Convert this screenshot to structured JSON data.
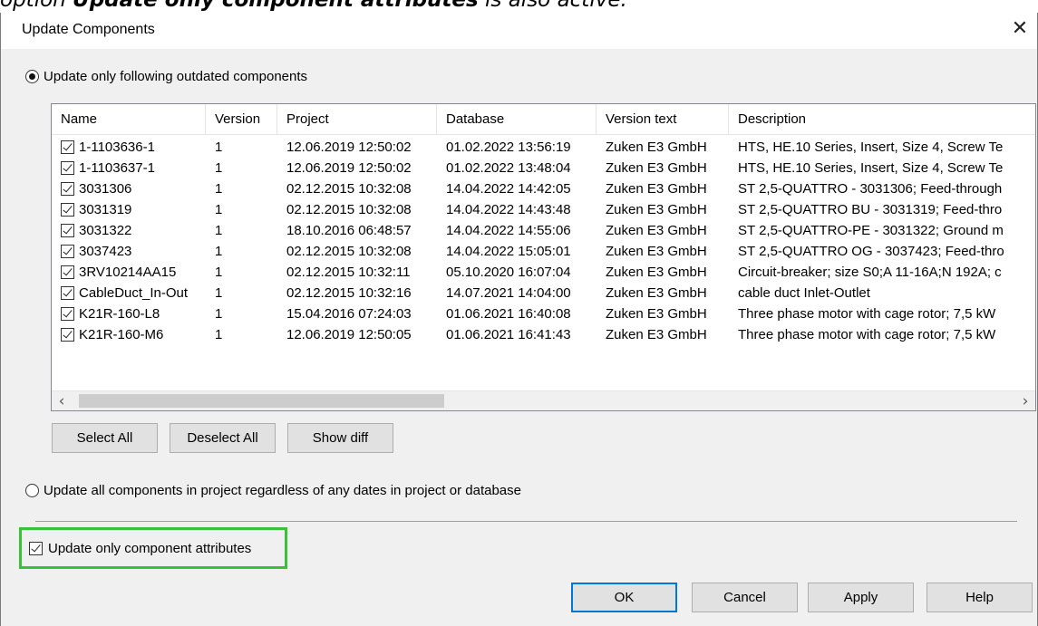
{
  "caption": {
    "prefix": "option ",
    "bold_part": "Update only component attributes",
    "suffix": " is also active."
  },
  "dialog": {
    "title": "Update Components",
    "close_glyph": "✕"
  },
  "option_outdated": {
    "label": "Update only following outdated components",
    "selected": true
  },
  "table": {
    "columns": [
      "Name",
      "Version",
      "Project",
      "Database",
      "Version text",
      "Description"
    ],
    "rows": [
      {
        "name": "1-1103636-1",
        "version": "1",
        "project": "12.06.2019 12:50:02",
        "database": "01.02.2022 13:56:19",
        "version_text": "Zuken E3 GmbH",
        "description": "HTS, HE.10 Series, Insert, Size 4, Screw Te"
      },
      {
        "name": "1-1103637-1",
        "version": "1",
        "project": "12.06.2019 12:50:02",
        "database": "01.02.2022 13:48:04",
        "version_text": "Zuken E3 GmbH",
        "description": "HTS, HE.10 Series, Insert, Size 4, Screw Te"
      },
      {
        "name": "3031306",
        "version": "1",
        "project": "02.12.2015 10:32:08",
        "database": "14.04.2022 14:42:05",
        "version_text": "Zuken E3 GmbH",
        "description": "ST 2,5-QUATTRO - 3031306; Feed-through"
      },
      {
        "name": "3031319",
        "version": "1",
        "project": "02.12.2015 10:32:08",
        "database": "14.04.2022 14:43:48",
        "version_text": "Zuken E3 GmbH",
        "description": "ST 2,5-QUATTRO BU - 3031319; Feed-thro"
      },
      {
        "name": "3031322",
        "version": "1",
        "project": "18.10.2016 06:48:57",
        "database": "14.04.2022 14:55:06",
        "version_text": "Zuken E3 GmbH",
        "description": "ST 2,5-QUATTRO-PE - 3031322; Ground m"
      },
      {
        "name": "3037423",
        "version": "1",
        "project": "02.12.2015 10:32:08",
        "database": "14.04.2022 15:05:01",
        "version_text": "Zuken E3 GmbH",
        "description": "ST 2,5-QUATTRO OG - 3037423; Feed-thro"
      },
      {
        "name": "3RV10214AA15",
        "version": "1",
        "project": "02.12.2015 10:32:11",
        "database": "05.10.2020 16:07:04",
        "version_text": "Zuken E3 GmbH",
        "description": "Circuit-breaker; size S0;A 11-16A;N 192A; c"
      },
      {
        "name": "CableDuct_In-Out",
        "version": "1",
        "project": "02.12.2015 10:32:16",
        "database": "14.07.2021 14:04:00",
        "version_text": "Zuken E3 GmbH",
        "description": "cable duct Inlet-Outlet"
      },
      {
        "name": "K21R-160-L8",
        "version": "1",
        "project": "15.04.2016 07:24:03",
        "database": "01.06.2021 16:40:08",
        "version_text": "Zuken E3 GmbH",
        "description": "Three phase motor with cage rotor; 7,5 kW"
      },
      {
        "name": "K21R-160-M6",
        "version": "1",
        "project": "12.06.2019 12:50:05",
        "database": "01.06.2021 16:41:43",
        "version_text": "Zuken E3 GmbH",
        "description": "Three phase motor with cage rotor; 7,5 kW"
      }
    ]
  },
  "scroll": {
    "left_glyph": "‹",
    "right_glyph": "›"
  },
  "list_buttons": {
    "select_all": "Select All",
    "deselect_all": "Deselect All",
    "show_diff": "Show diff"
  },
  "option_all": {
    "label": "Update all components in project regardless of any dates in project or database",
    "selected": false
  },
  "option_attributes": {
    "label": "Update only component attributes",
    "checked": true
  },
  "footer_buttons": {
    "ok": "OK",
    "cancel": "Cancel",
    "apply": "Apply",
    "help": "Help"
  },
  "colors": {
    "highlight": "#37c23a",
    "default_button_border": "#0078d7",
    "dialog_background": "#f0f0f0"
  }
}
